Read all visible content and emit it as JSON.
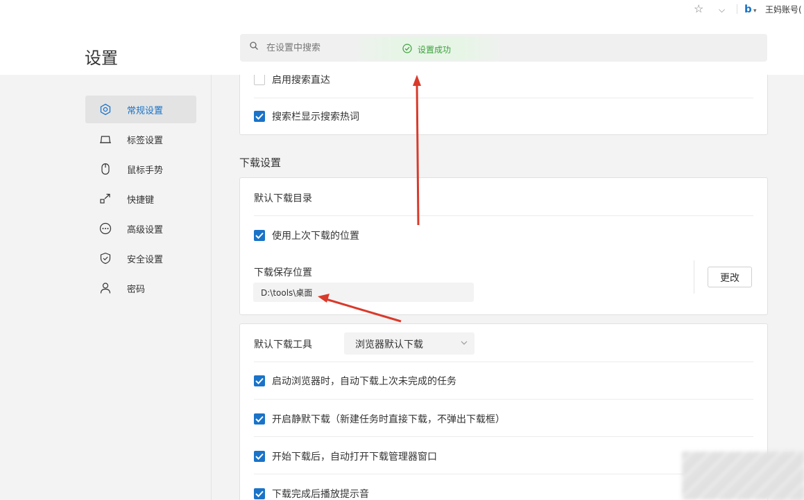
{
  "toolbar": {
    "star_icon": "star-icon",
    "chevron_icon": "chevron-down-icon",
    "search_engine": "b",
    "account_label": "王妈账号("
  },
  "header": {
    "title": "设置",
    "search_placeholder": "在设置中搜索",
    "toast_text": "设置成功"
  },
  "sidebar": {
    "items": [
      {
        "label": "常规设置",
        "icon": "hexagon-gear-icon",
        "active": true
      },
      {
        "label": "标签设置",
        "icon": "tab-icon"
      },
      {
        "label": "鼠标手势",
        "icon": "mouse-icon"
      },
      {
        "label": "快捷键",
        "icon": "shortcut-arrow-icon"
      },
      {
        "label": "高级设置",
        "icon": "more-dots-icon"
      },
      {
        "label": "安全设置",
        "icon": "shield-icon"
      },
      {
        "label": "密码",
        "icon": "person-icon"
      }
    ]
  },
  "search_card": {
    "items": [
      {
        "label": "启用搜索直达",
        "checked": false
      },
      {
        "label": "搜索栏显示搜索热词",
        "checked": true
      }
    ]
  },
  "download": {
    "section_title": "下载设置",
    "default_dir_label": "默认下载目录",
    "use_last_location": {
      "label": "使用上次下载的位置",
      "checked": true
    },
    "save_location_label": "下载保存位置",
    "save_path": "D:\\tools\\桌面",
    "change_button": "更改",
    "tool_label": "默认下载工具",
    "tool_value": "浏览器默认下载",
    "options": [
      {
        "label": "启动浏览器时，自动下载上次未完成的任务",
        "checked": true
      },
      {
        "label": "开启静默下载（新建任务时直接下载，不弹出下载框）",
        "checked": true
      },
      {
        "label": "开始下载后，自动打开下载管理器窗口",
        "checked": true
      },
      {
        "label": "下载完成后播放提示音",
        "checked": true
      }
    ]
  },
  "colors": {
    "accent": "#1a73c8",
    "success": "#3ca03c",
    "annotation_arrow": "#d93a2b"
  }
}
